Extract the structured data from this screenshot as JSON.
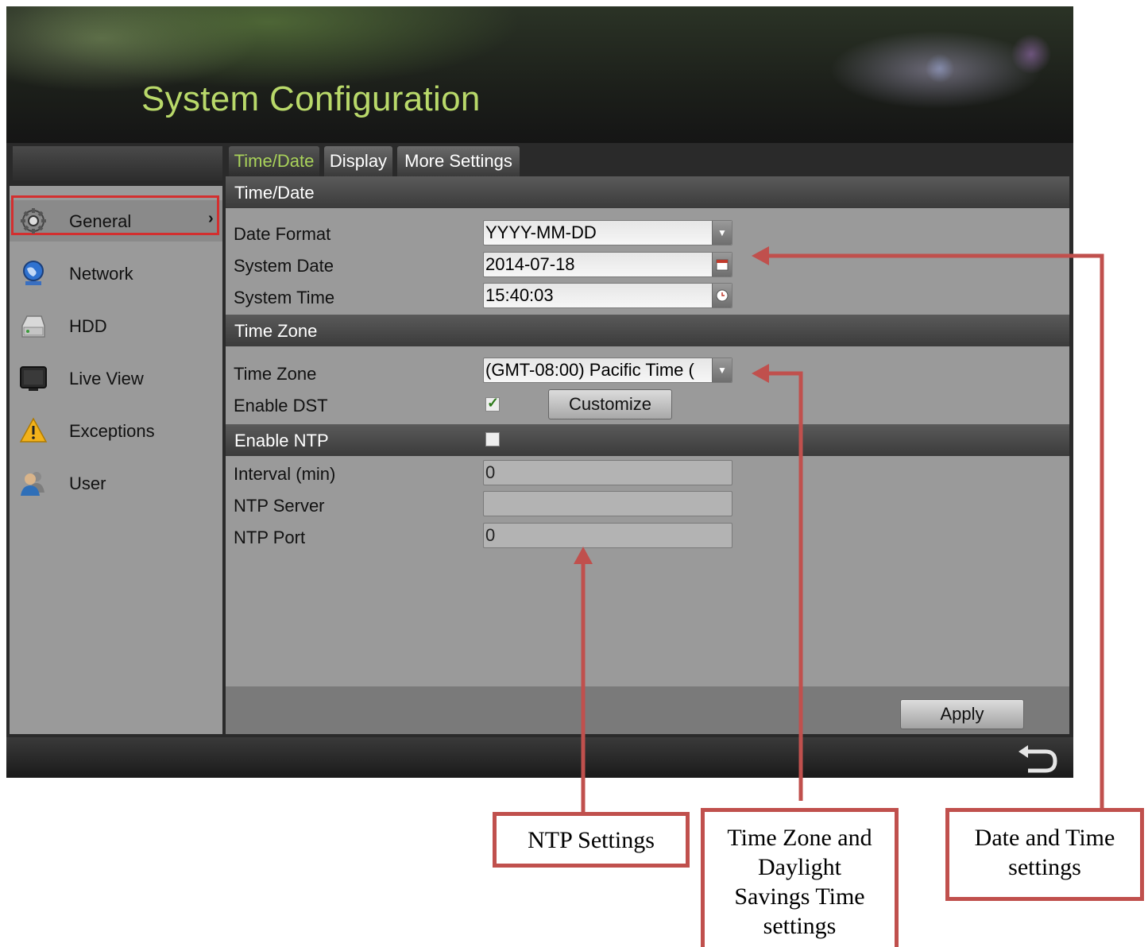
{
  "header": {
    "title": "System Configuration"
  },
  "sidebar": {
    "items": [
      {
        "label": "General",
        "icon": "gear-icon",
        "selected": true
      },
      {
        "label": "Network",
        "icon": "globe-icon"
      },
      {
        "label": "HDD",
        "icon": "hard-drive-icon"
      },
      {
        "label": "Live View",
        "icon": "monitor-icon"
      },
      {
        "label": "Exceptions",
        "icon": "warning-icon"
      },
      {
        "label": "User",
        "icon": "users-icon"
      }
    ]
  },
  "tabs": [
    {
      "label": "Time/Date",
      "active": true
    },
    {
      "label": "Display"
    },
    {
      "label": "More Settings"
    }
  ],
  "sections": {
    "time_date": {
      "title": "Time/Date",
      "date_format_label": "Date Format",
      "date_format_value": "YYYY-MM-DD",
      "system_date_label": "System Date",
      "system_date_value": "2014-07-18",
      "system_time_label": "System Time",
      "system_time_value": "15:40:03"
    },
    "time_zone": {
      "title": "Time Zone",
      "time_zone_label": "Time Zone",
      "time_zone_value": "(GMT-08:00) Pacific Time (",
      "enable_dst_label": "Enable DST",
      "enable_dst_checked": true,
      "customize_label": "Customize"
    },
    "ntp": {
      "title": "Enable NTP",
      "enabled": false,
      "interval_label": "Interval (min)",
      "interval_value": "0",
      "server_label": "NTP Server",
      "server_value": "",
      "port_label": "NTP Port",
      "port_value": "0"
    }
  },
  "footer": {
    "apply_label": "Apply"
  },
  "annotations": {
    "ntp": "NTP Settings",
    "timezone_line1": "Time Zone and",
    "timezone_line2": "Daylight",
    "timezone_line3": "Savings Time",
    "timezone_line4": "settings",
    "datetime_line1": "Date and Time",
    "datetime_line2": "settings",
    "color": "#c0504d"
  },
  "colors": {
    "title": "#b9d96a",
    "active_tab": "#a9d25a",
    "panel": "#9a9a9a",
    "highlight": "#d32f2f"
  }
}
